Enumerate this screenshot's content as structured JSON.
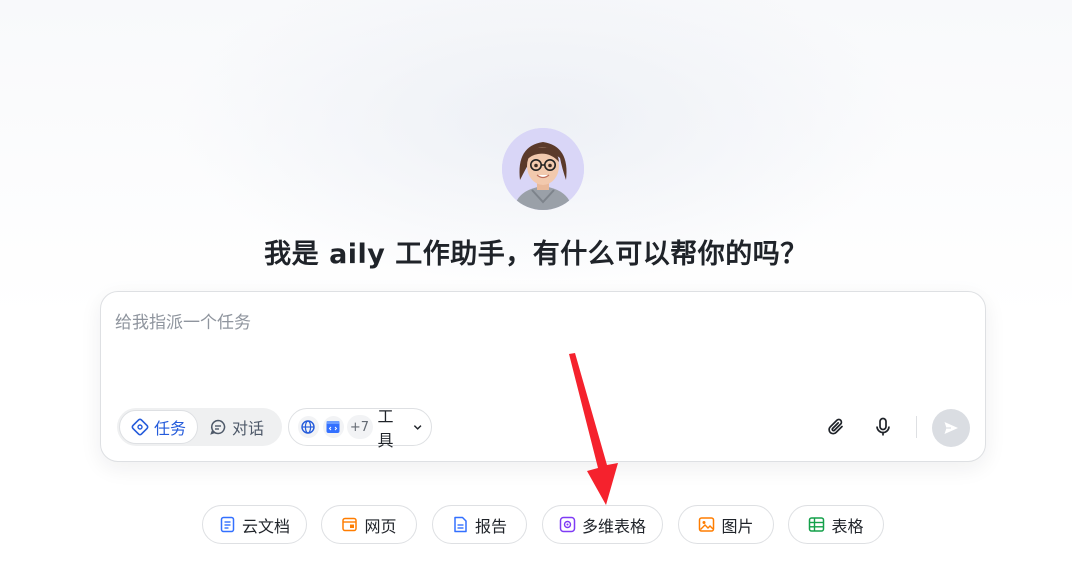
{
  "headline": "我是 aily 工作助手，有什么可以帮你的吗？",
  "input": {
    "placeholder": "给我指派一个任务",
    "value": ""
  },
  "modes": [
    {
      "label": "任务",
      "icon": "task-icon",
      "active": true
    },
    {
      "label": "对话",
      "icon": "chat-icon",
      "active": false
    }
  ],
  "tools": {
    "label": "工具",
    "extra_count": "+7",
    "icons": [
      "globe-icon",
      "code-icon"
    ]
  },
  "actions": {
    "attach_icon": "paperclip-icon",
    "mic_icon": "microphone-icon",
    "send_icon": "send-icon"
  },
  "quick_chips": [
    {
      "label": "云文档",
      "icon": "doc-icon",
      "color": "#3370ff"
    },
    {
      "label": "网页",
      "icon": "webpage-icon",
      "color": "#ff7d00"
    },
    {
      "label": "报告",
      "icon": "report-icon",
      "color": "#3370ff"
    },
    {
      "label": "多维表格",
      "icon": "bitable-icon",
      "color": "#7f3bf5"
    },
    {
      "label": "图片",
      "icon": "image-icon",
      "color": "#ff7d00"
    },
    {
      "label": "表格",
      "icon": "sheet-icon",
      "color": "#14a04a"
    }
  ],
  "colors": {
    "accent": "#245bdb",
    "annotation_arrow": "#f5222d"
  }
}
